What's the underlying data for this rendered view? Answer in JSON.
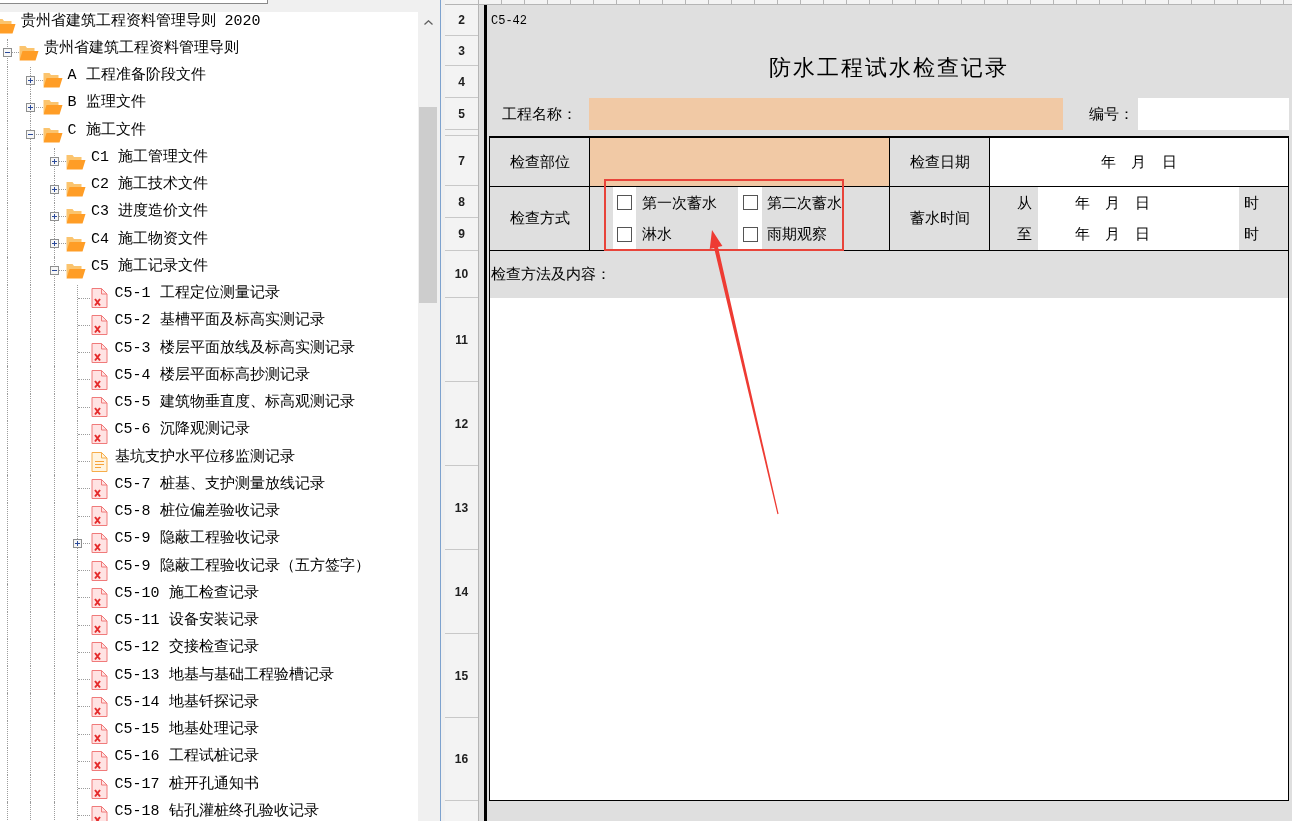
{
  "tree": [
    {
      "label": "贵州省建筑工程资料管理导则 2020",
      "kind": "folder",
      "children": [
        {
          "label": "贵州省建筑工程资料管理导则",
          "kind": "folder",
          "expanded": true,
          "children": [
            {
              "label": "A 工程准备阶段文件",
              "kind": "folder",
              "expanded": false
            },
            {
              "label": "B 监理文件",
              "kind": "folder",
              "expanded": false
            },
            {
              "label": "C 施工文件",
              "kind": "folder",
              "expanded": true,
              "children": [
                {
                  "label": "C1 施工管理文件",
                  "kind": "folder",
                  "expanded": false
                },
                {
                  "label": "C2 施工技术文件",
                  "kind": "folder",
                  "expanded": false
                },
                {
                  "label": "C3 进度造价文件",
                  "kind": "folder",
                  "expanded": false
                },
                {
                  "label": "C4 施工物资文件",
                  "kind": "folder",
                  "expanded": false
                },
                {
                  "label": "C5 施工记录文件",
                  "kind": "folder",
                  "expanded": true,
                  "children": [
                    {
                      "label": "C5-1 工程定位测量记录",
                      "kind": "form"
                    },
                    {
                      "label": "C5-2 基槽平面及标高实测记录",
                      "kind": "form"
                    },
                    {
                      "label": "C5-3 楼层平面放线及标高实测记录",
                      "kind": "form"
                    },
                    {
                      "label": "C5-4 楼层平面标高抄测记录",
                      "kind": "form"
                    },
                    {
                      "label": "C5-5 建筑物垂直度、标高观测记录",
                      "kind": "form"
                    },
                    {
                      "label": "C5-6 沉降观测记录",
                      "kind": "form"
                    },
                    {
                      "label": "基坑支护水平位移监测记录",
                      "kind": "document"
                    },
                    {
                      "label": "C5-7 桩基、支护测量放线记录",
                      "kind": "form"
                    },
                    {
                      "label": "C5-8 桩位偏差验收记录",
                      "kind": "form"
                    },
                    {
                      "label": "C5-9 隐蔽工程验收记录",
                      "kind": "form",
                      "expanded": false
                    },
                    {
                      "label": "C5-9 隐蔽工程验收记录（五方签字）",
                      "kind": "form"
                    },
                    {
                      "label": "C5-10 施工检查记录",
                      "kind": "form"
                    },
                    {
                      "label": "C5-11 设备安装记录",
                      "kind": "form"
                    },
                    {
                      "label": "C5-12 交接检查记录",
                      "kind": "form"
                    },
                    {
                      "label": "C5-13 地基与基础工程验槽记录",
                      "kind": "form"
                    },
                    {
                      "label": "C5-14 地基钎探记录",
                      "kind": "form"
                    },
                    {
                      "label": "C5-15 地基处理记录",
                      "kind": "form"
                    },
                    {
                      "label": "C5-16 工程试桩记录",
                      "kind": "form"
                    },
                    {
                      "label": "C5-17 桩开孔通知书",
                      "kind": "form"
                    },
                    {
                      "label": "C5-18 钻孔灌桩终孔验收记录",
                      "kind": "form"
                    }
                  ]
                }
              ]
            }
          ]
        }
      ]
    }
  ],
  "sheet": {
    "row_headers": [
      "2",
      "3",
      "4",
      "5",
      "7",
      "8",
      "9",
      "10",
      "11",
      "12",
      "13",
      "14",
      "15",
      "16"
    ],
    "form": {
      "code": "C5-42",
      "title": "防水工程试水检查记录",
      "project_name_label": "工程名称：",
      "number_label": "编号：",
      "inspection_part_label": "检查部位",
      "inspection_date": {
        "label": "检查日期",
        "date": "年 月 日"
      },
      "method": {
        "label": "检查方式",
        "options": [
          {
            "label": "第一次蓄水",
            "checked": false
          },
          {
            "label": "第二次蓄水",
            "checked": false
          },
          {
            "label": "淋水",
            "checked": false
          },
          {
            "label": "雨期观察",
            "checked": false
          }
        ]
      },
      "storage_time": {
        "label": "蓄水时间",
        "rows": [
          {
            "prefix": "从",
            "date": "年 月 日",
            "suffix": "时"
          },
          {
            "prefix": "至",
            "date": "年 月 日",
            "suffix": "时"
          }
        ]
      },
      "content_label": "检查方法及内容："
    }
  }
}
